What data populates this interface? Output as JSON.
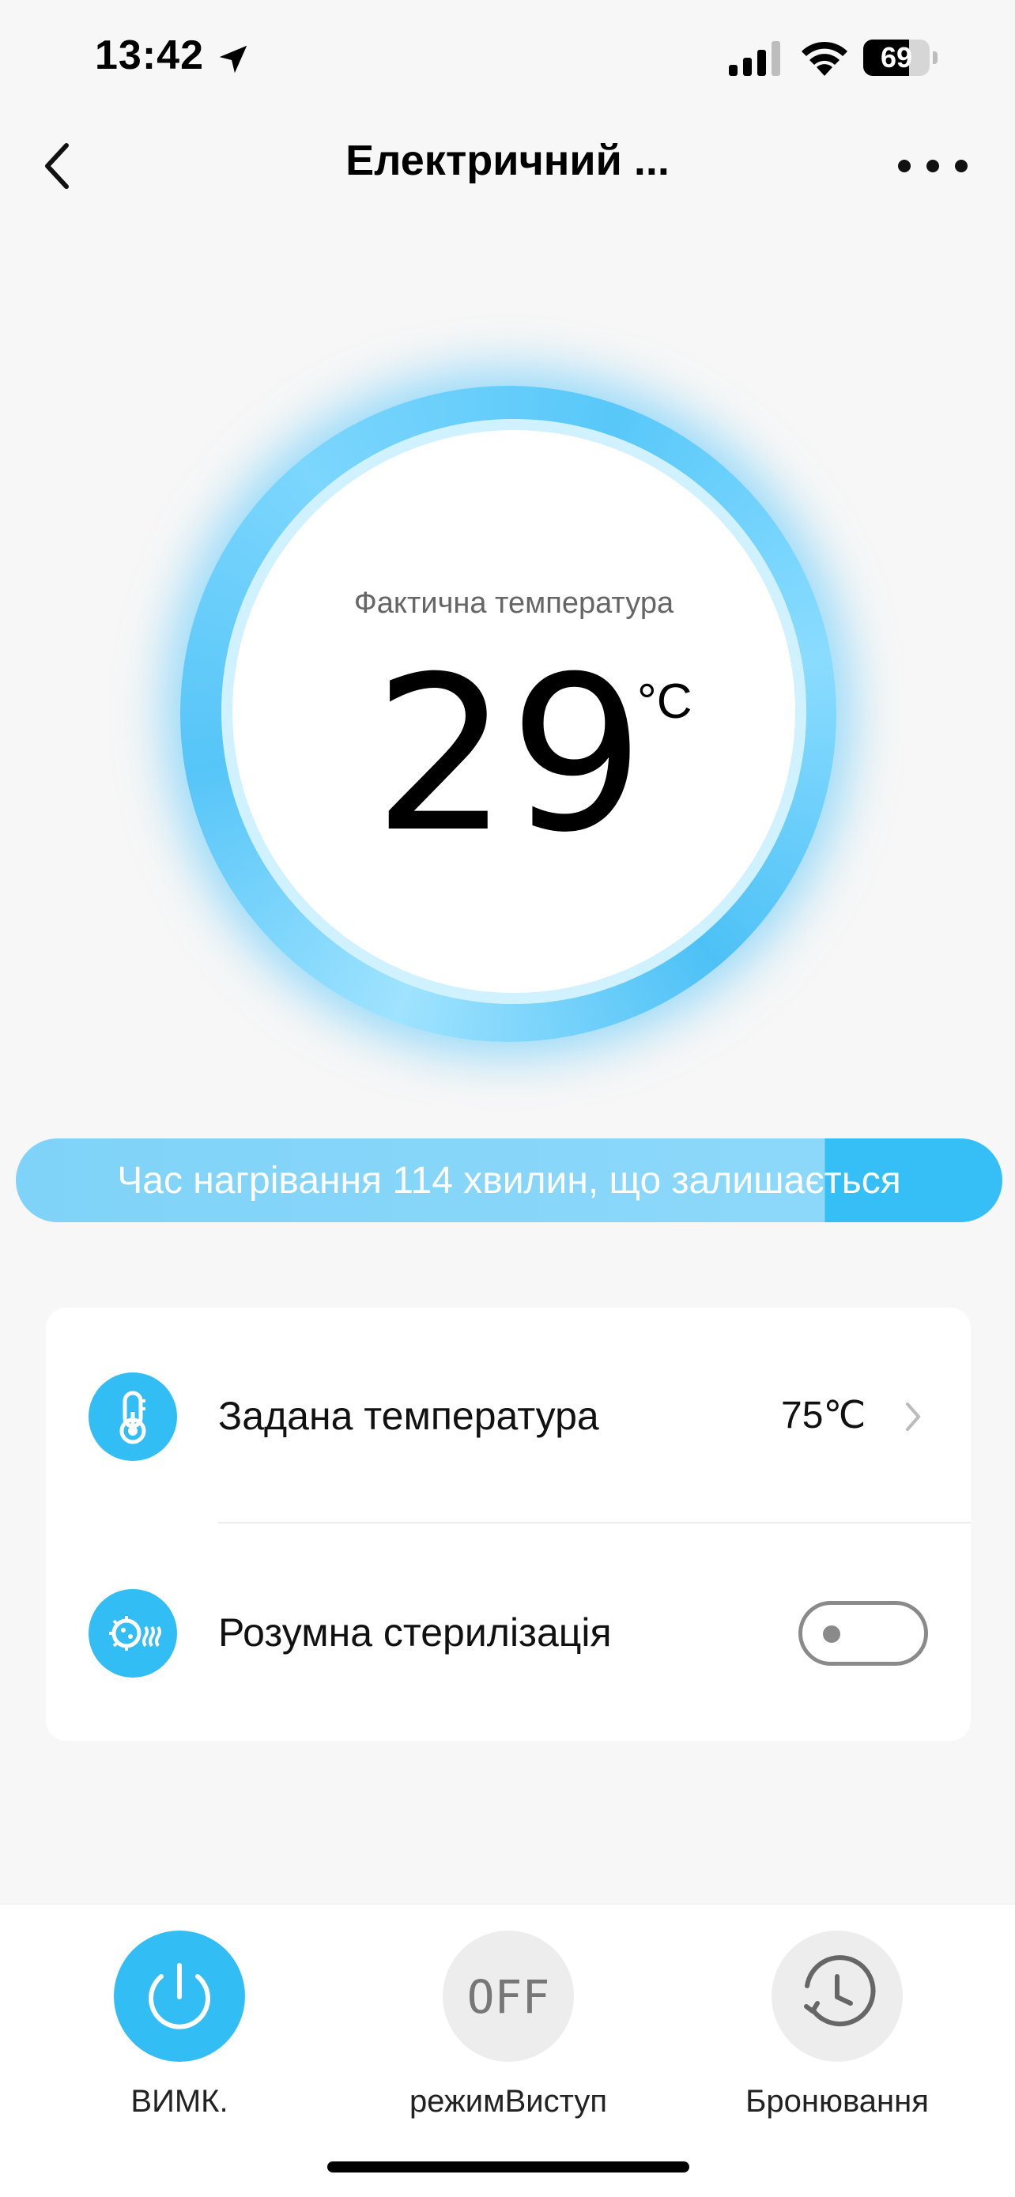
{
  "status_bar": {
    "time": "13:42",
    "battery": "69",
    "battery_level": 0.69
  },
  "nav": {
    "title": "Електричний ..."
  },
  "thermostat": {
    "label": "Фактична температура",
    "value": "29",
    "unit": "°C"
  },
  "banner": {
    "text": "Час нагрівання 114 хвилин, що залишається",
    "progress": 0.82
  },
  "settings": {
    "set_temperature": {
      "label": "Задана температура",
      "value": "75℃",
      "icon": "thermometer-icon"
    },
    "smart_sterilization": {
      "label": "Розумна стерилізація",
      "enabled": false,
      "icon": "sterilization-icon"
    }
  },
  "bottom_bar": {
    "power": {
      "label": "ВИМК.",
      "icon": "power-icon"
    },
    "mode": {
      "label": "режимВиступ",
      "icon_text": "OFF"
    },
    "booking": {
      "label": "Бронювання",
      "icon": "clock-icon"
    }
  },
  "colors": {
    "accent": "#33bdf5",
    "background": "#f7f7f7"
  }
}
